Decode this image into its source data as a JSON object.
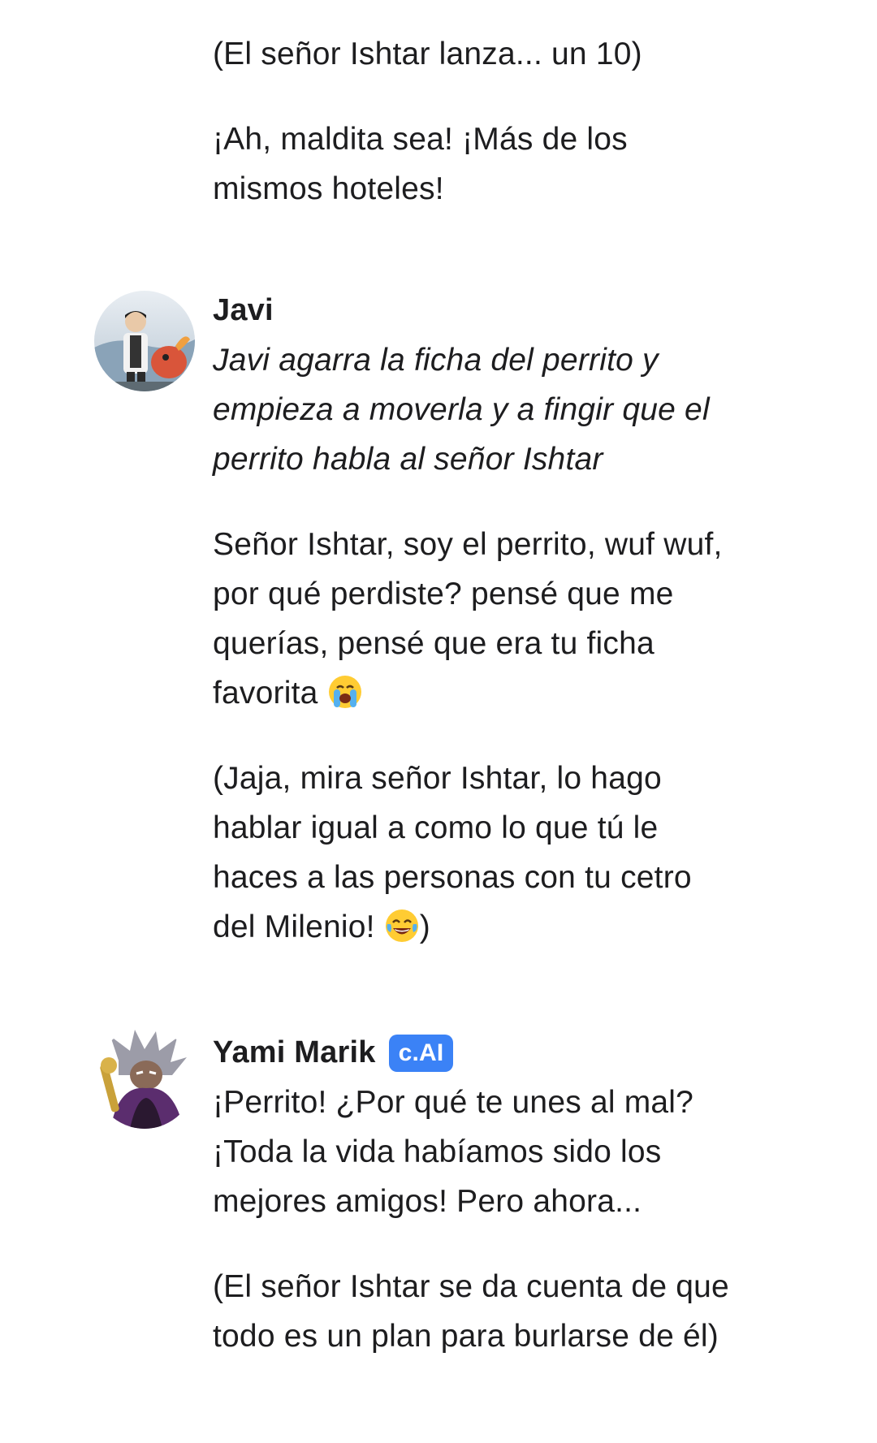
{
  "messages": [
    {
      "author": "",
      "paragraphs": [
        "(El señor Ishtar lanza... un 10)",
        "¡Ah, maldita sea! ¡Más de los mismos hoteles!"
      ]
    },
    {
      "author": "Javi",
      "avatar": "javi-avatar",
      "paragraphs": [
        "Javi agarra la ficha del perrito y empieza a moverla y a fingir que el perrito habla al señor Ishtar",
        "Señor Ishtar, soy el perrito, wuf wuf, por qué perdiste? pensé que me querías, pensé que era tu ficha favorita",
        "(Jaja, mira señor Ishtar, lo hago hablar igual a como lo que tú le haces a las personas con tu cetro del Milenio!",
        ")"
      ],
      "emojis": [
        "loudly-crying-face-icon",
        "face-with-tears-of-joy-icon"
      ]
    },
    {
      "author": "Yami Marik",
      "badge": "c.AI",
      "avatar": "yami-marik-avatar",
      "paragraphs": [
        "¡Perrito! ¿Por qué te unes al mal? ¡Toda la vida habíamos sido los mejores amigos! Pero ahora...",
        "(El señor Ishtar se da cuenta de que todo es un plan para burlarse de él)"
      ]
    }
  ],
  "colors": {
    "badge_bg": "#3b82f6",
    "text": "#1d1d1f",
    "background": "#ffffff"
  }
}
